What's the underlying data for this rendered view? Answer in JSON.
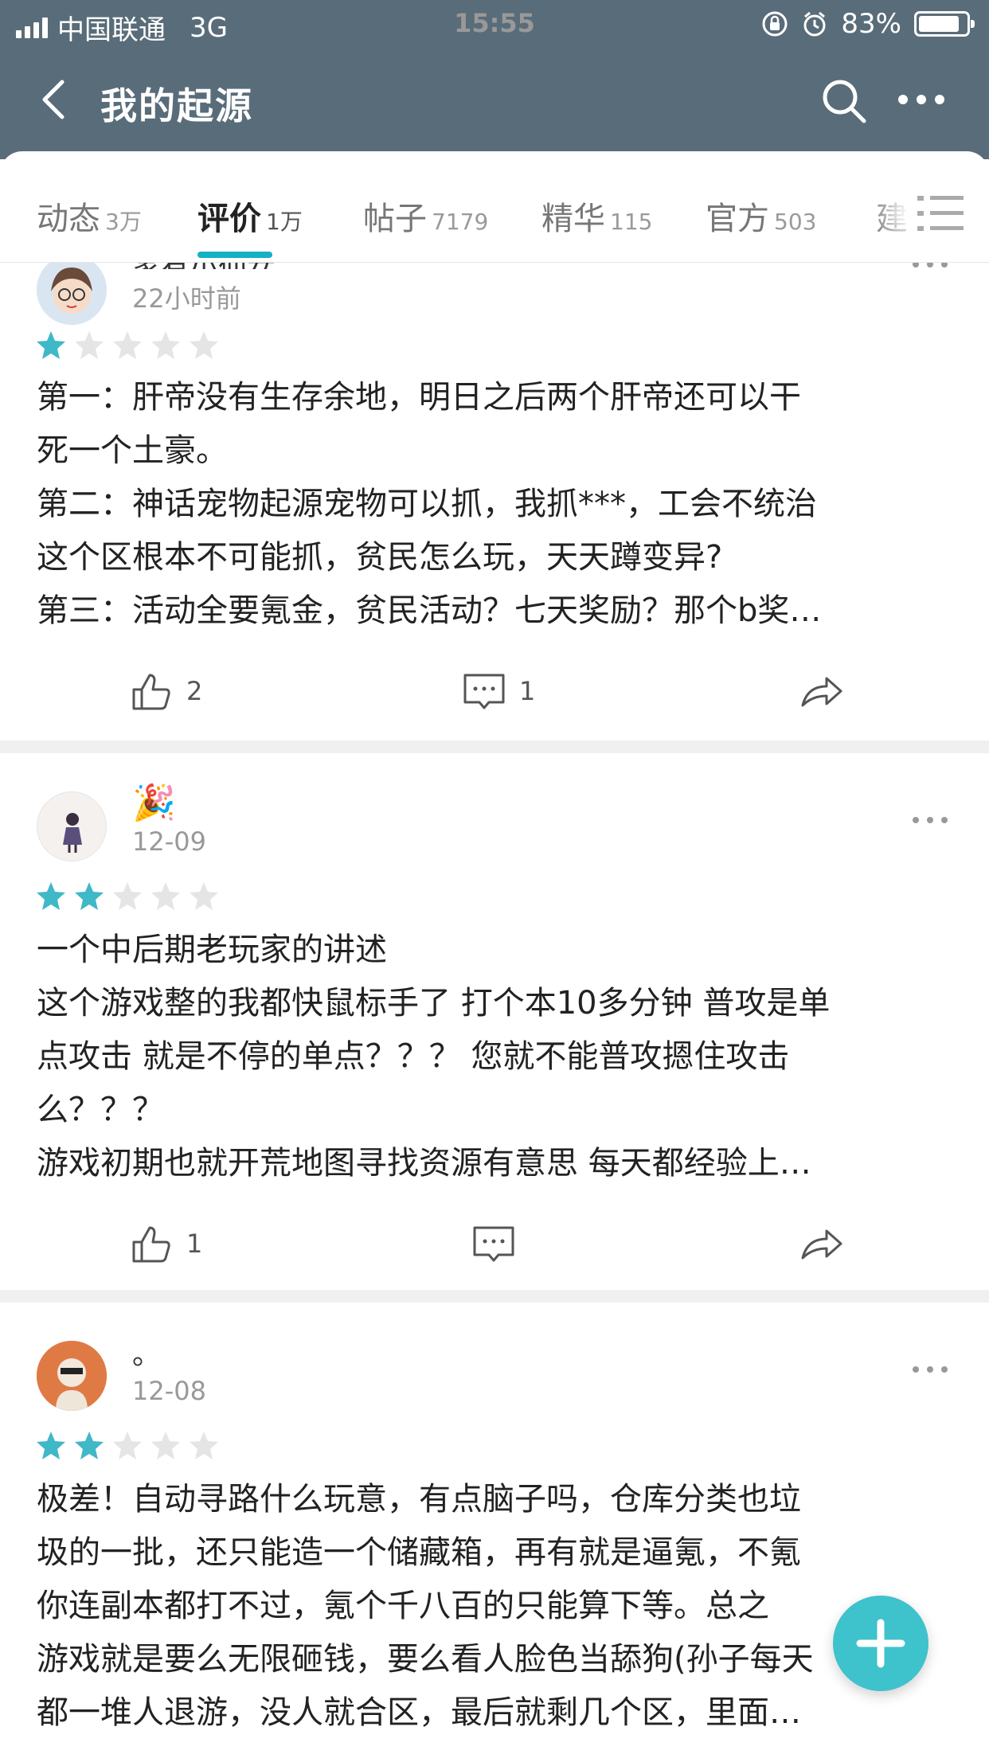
{
  "status_bar": {
    "carrier": "中国联通",
    "network": "3G",
    "time": "15:55",
    "battery": "83%",
    "battery_level": 0.83
  },
  "navbar": {
    "title": "我的起源"
  },
  "tabs": [
    {
      "label": "动态",
      "count": "3万"
    },
    {
      "label": "评价",
      "count": "1万"
    },
    {
      "label": "帖子",
      "count": "7179"
    },
    {
      "label": "精华",
      "count": "115"
    },
    {
      "label": "官方",
      "count": "503"
    },
    {
      "label": "建",
      "count": ""
    }
  ],
  "active_tab_index": 1,
  "colors": {
    "header": "#596c79",
    "accent": "#16b1c2",
    "star_filled": "#3fb8c8",
    "star_empty": "#e5e5e5"
  },
  "reviews": [
    {
      "username": "家有小仙女",
      "time": "22小时前",
      "rating": 1,
      "lines": [
        "第一：肝帝没有生存余地，明日之后两个肝帝还可以干",
        "死一个土豪。",
        "第二：神话宠物起源宠物可以抓，我抓***，工会不统治",
        "这个区根本不可能抓，贫民怎么玩，天天蹲变异?",
        "第三：活动全要氪金，贫民活动？七天奖励？那个b奖…"
      ],
      "likes": "2",
      "comments": "1"
    },
    {
      "username": "🎉",
      "time": "12-09",
      "rating": 2,
      "lines": [
        "一个中后期老玩家的讲述",
        "这个游戏整的我都快鼠标手了 打个本10多分钟 普攻是单",
        "点攻击 就是不停的单点？？？ 您就不能普攻摁住攻击",
        "么？？？",
        "游戏初期也就开荒地图寻找资源有意思 每天都经验上…"
      ],
      "likes": "1",
      "comments": ""
    },
    {
      "username": "。",
      "time": "12-08",
      "rating": 2,
      "lines": [
        "极差！自动寻路什么玩意，有点脑子吗，仓库分类也垃",
        "圾的一批，还只能造一个储藏箱，再有就是逼氪，不氪",
        "你连副本都打不过，氪个千八百的只能算下等。总之",
        "游戏就是要么无限砸钱，要么看人脸色当舔狗(孙子每天",
        "都一堆人退游，没人就合区，最后就剩几个区，里面…"
      ],
      "likes": "",
      "comments": ""
    }
  ]
}
